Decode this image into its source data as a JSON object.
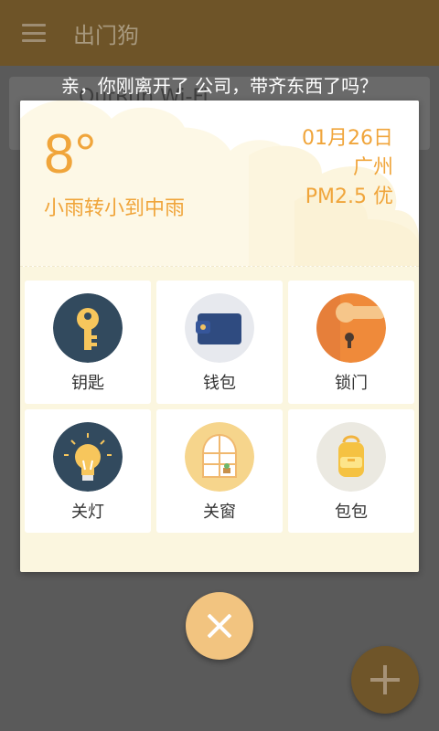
{
  "app": {
    "title": "出门狗",
    "wifi_name": "OutRun Wi-Fi"
  },
  "prompt": "亲，你刚离开了 公司，带齐东西了吗？",
  "weather": {
    "temperature": "8°",
    "description": "小雨转小到中雨",
    "date": "01月26日",
    "city": "广州",
    "air_quality": "PM2.5 优"
  },
  "items": [
    {
      "label": "钥匙",
      "icon": "key-icon"
    },
    {
      "label": "钱包",
      "icon": "wallet-icon"
    },
    {
      "label": "锁门",
      "icon": "door-lock-icon"
    },
    {
      "label": "关灯",
      "icon": "light-bulb-icon"
    },
    {
      "label": "关窗",
      "icon": "window-icon"
    },
    {
      "label": "包包",
      "icon": "bag-icon"
    }
  ],
  "colors": {
    "accent": "#f0a53b",
    "dialog_bg": "#fbf6df",
    "appbar": "#6e5428",
    "close_fab": "#f2c480"
  }
}
